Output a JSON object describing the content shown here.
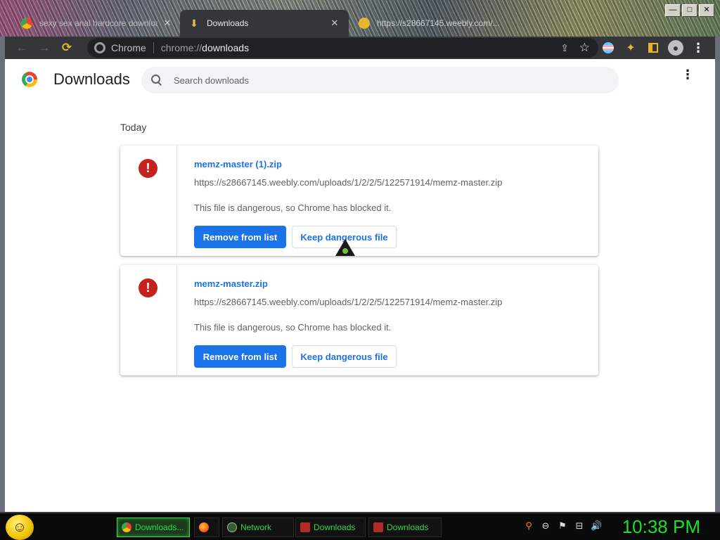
{
  "window": {
    "tabs": [
      {
        "label": "sexy sex anal hardcore downloa",
        "close": "✕"
      },
      {
        "label": "Downloads",
        "close": "✕"
      },
      {
        "label": "https://s28667145.weebly.com/..."
      }
    ],
    "controls": {
      "minimize": "—",
      "maximize": "□",
      "close": "✕"
    }
  },
  "toolbar": {
    "back": "←",
    "forward": "→",
    "reload": "⟳",
    "site_label": "Chrome",
    "url_scheme": "chrome://",
    "url_host": "downloads",
    "share": "⇪",
    "bookmark": "☆",
    "extensions": "✦",
    "profile": "●",
    "menu": "⋮"
  },
  "page": {
    "title": "Downloads",
    "search_placeholder": "Search downloads",
    "menu": "⋮",
    "section": "Today",
    "downloads": [
      {
        "file_name": "memz-master (1).zip",
        "url": "https://s28667145.weebly.com/uploads/1/2/2/5/122571914/memz-master.zip",
        "status": "This file is dangerous, so Chrome has blocked it.",
        "remove_label": "Remove from list",
        "keep_label": "Keep dangerous file",
        "warning_glyph": "!"
      },
      {
        "file_name": "memz-master.zip",
        "url": "https://s28667145.weebly.com/uploads/1/2/2/5/122571914/memz-master.zip",
        "status": "This file is dangerous, so Chrome has blocked it.",
        "remove_label": "Remove from list",
        "keep_label": "Keep dangerous file",
        "warning_glyph": "!"
      }
    ]
  },
  "taskbar": {
    "start_glyph": "☺",
    "tasks": [
      {
        "label": "Downloads..."
      },
      {
        "label": ""
      },
      {
        "label": "Network"
      },
      {
        "label": "Downloads"
      },
      {
        "label": "Downloads"
      }
    ],
    "tray": [
      "⚲",
      "⊖",
      "⚑",
      "⊟",
      "🔊"
    ],
    "clock": "10:38 PM"
  },
  "colors": {
    "accent": "#1a73e8",
    "danger": "#c5221f",
    "taskbar_text": "#31d84a",
    "clock": "#19e02a"
  }
}
